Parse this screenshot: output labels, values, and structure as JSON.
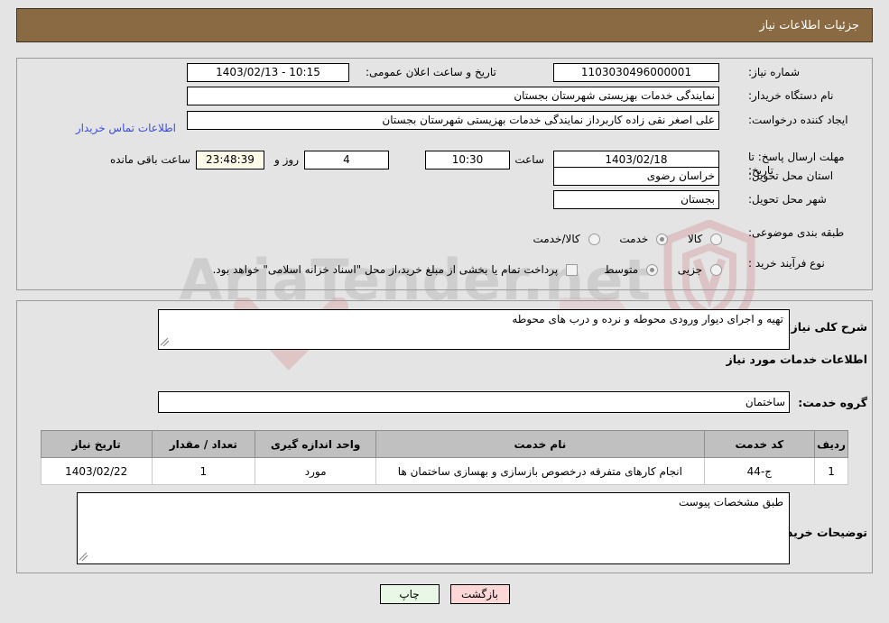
{
  "window": {
    "title": "جزئیات اطلاعات نیاز"
  },
  "colors": {
    "title_bar": "#8a6a42",
    "page_background": "#e4e4e4",
    "link": "#3b4fd8",
    "table_header": "#c0c0c0",
    "print_button": "#e8f7e6",
    "back_button": "#fcd7d7",
    "countdown_field": "#fbfbe8"
  },
  "watermark": {
    "text": "AriaTender.net",
    "logo": "shield-logo"
  },
  "top_panel": {
    "need_number": {
      "label": "شماره نیاز:",
      "value": "1103030496000001"
    },
    "public_announcement": {
      "label": "تاریخ و ساعت اعلان عمومی:",
      "value": "10:15 - 1403/02/13"
    },
    "buyer_org": {
      "label": "نام دستگاه خریدار:",
      "value": "نمایندگی خدمات بهزیستی شهرستان بجستان"
    },
    "request_creator": {
      "label": "ایجاد کننده درخواست:",
      "value": "علی اصغر نقی زاده کاربرداز نمایندگی خدمات بهزیستی شهرستان بجستان"
    },
    "contact_link": "اطلاعات تماس خریدار",
    "response_deadline": {
      "label": "مهلت ارسال پاسخ: تا تاریخ:",
      "date": "1403/02/18",
      "time_label": "ساعت",
      "time": "10:30",
      "days": "4",
      "days_label": "روز و",
      "countdown": "23:48:39",
      "countdown_label": "ساعت باقی مانده"
    },
    "delivery_province": {
      "label": "استان محل تحویل:",
      "value": "خراسان رضوی"
    },
    "delivery_city": {
      "label": "شهر محل تحویل:",
      "value": "بجستان"
    },
    "subject_category": {
      "label": "طبقه بندی موضوعی:",
      "options": [
        "کالا",
        "خدمت",
        "کالا/خدمت"
      ],
      "selected": "خدمت"
    },
    "purchase_process": {
      "label": "نوع فرآیند خرید :",
      "options": [
        "جزیی",
        "متوسط"
      ],
      "selected": "متوسط"
    },
    "treasury_note": {
      "checked": false,
      "text": "پرداخت تمام یا بخشی از مبلغ خرید،از محل \"اسناد خزانه اسلامی\" خواهد بود."
    }
  },
  "bottom_panel": {
    "general_description": {
      "label": "شرح کلی نیاز:",
      "value": "تهیه و اجرای دیوار ورودی محوطه و نرده و درب های محوطه"
    },
    "services_heading": "اطلاعات خدمات مورد نیاز",
    "service_group": {
      "label": "گروه خدمت:",
      "value": "ساختمان"
    },
    "table": {
      "headers": [
        "ردیف",
        "کد خدمت",
        "نام خدمت",
        "واحد اندازه گیری",
        "تعداد / مقدار",
        "تاریخ نیاز"
      ],
      "rows": [
        {
          "radif": "1",
          "code": "ج-44",
          "name": "انجام کارهای متفرقه درخصوص بازسازی و بهسازی ساختمان ها",
          "unit": "مورد",
          "quantity": "1",
          "date": "1403/02/22"
        }
      ]
    },
    "buyer_comments": {
      "label": "توضیحات خریدار:",
      "value": "طبق مشخصات پیوست"
    }
  },
  "footer": {
    "print_label": "چاپ",
    "back_label": "بازگشت"
  }
}
